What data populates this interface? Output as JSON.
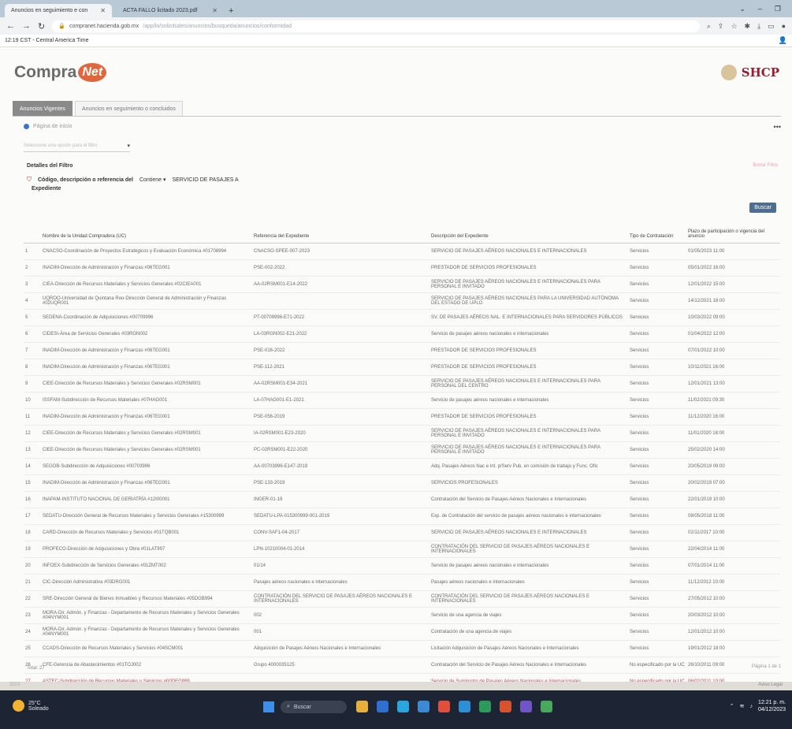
{
  "browser": {
    "tabs": [
      {
        "label": "Anuncios en seguimiento e con"
      },
      {
        "label": "ACTA FALLO licitado 2023.pdf"
      }
    ],
    "url_prefix": "compranet.hacienda.gob.mx",
    "url_rest": "/app/lo/solicitudes/anuncios/busqueda/anuncios/conformidad",
    "bookmark_item": "12:19 CST - Central America Time"
  },
  "site": {
    "logo_text": "Compra",
    "logo_net": "Net",
    "shcp_label": "SHCP"
  },
  "page_tabs": [
    {
      "label": "Anuncios Vigentes"
    },
    {
      "label": "Anuncios en seguimiento o concluidos"
    }
  ],
  "home_label": "Página de inicio",
  "select_placeholder": "Seleccione una opción para el filtro",
  "filters": {
    "title": "Detalles del Filtro",
    "clear": "Borrar Filtro",
    "field": "Código, descripción o referencia del",
    "field_2": "Expediente",
    "operator": "Contiene ▾",
    "value": "SERVICIO DE PASAJES A"
  },
  "search_button": "Buscar",
  "table": {
    "headers": [
      "",
      "Nombre de la Unidad Compradora (UC)",
      "Referencia del Expediente",
      "Descripción del Expediente",
      "Tipo de Contratación",
      "Plazo de participación o vigencia del anuncio"
    ],
    "rows": [
      [
        "1",
        "CNACSO-Coordinación de Proyectos Estratégicos y Evaluación Económica #01708994",
        "CNACSO-SPEE-007-2023",
        "SERVICIO DE PASAJES AÉREOS NACIONALES E INTERNACIONALES",
        "Servicios",
        "01/05/2023 11:00"
      ],
      [
        "2",
        "INADIM-Dirección de Administración y Finanzas #06TEG001",
        "PSE-002-2022",
        "PRESTADOR DE SERVICIOS PROFESIONALES",
        "Servicios",
        "05/01/2022 16:00"
      ],
      [
        "3",
        "CIEA-Dirección de Recursos Materiales y Servicios Generales #02CIEA001",
        "AA-02RSM001-E14-2022",
        "SERVICIO DE PASAJES AÉREOS NACIONALES E INTERNACIONALES PARA PERSONAL E INVITADO",
        "Servicios",
        "12/01/2022 15:00"
      ],
      [
        "4",
        "UQROO-Universidad de Quintana Roo-Dirección General de Administración y Finanzas #02UQR001",
        "",
        "SERVICIO DE PASAJES AÉREOS NACIONALES PARA LA UNIVERSIDAD AUTÓNOMA DEL ESTADO DE UPLO",
        "Servicios",
        "14/12/2021 16:00"
      ],
      [
        "5",
        "SEDENA-Coordinación de Adquisiciones #00709996",
        "PT-00709996-E71-2022",
        "SV. DE PASAJES AÉREOS NAL. E INTERNACIONALES PARA SERVIDORES PÚBLICOS",
        "Servicios",
        "10/03/2022 09:00"
      ],
      [
        "6",
        "CIDESI-Área de Servicios Generales #03RGN002",
        "LA-03RGN002-E21-2022",
        "Servicio de pasajes aéreos nacionales e internacionales",
        "Servicios",
        "01/04/2022 12:00"
      ],
      [
        "7",
        "INADIM-Dirección de Administración y Finanzas #06TEG001",
        "PSE-016-2022",
        "PRESTADOR DE SERVICIOS PROFESIONALES",
        "Servicios",
        "07/01/2022 10:00"
      ],
      [
        "8",
        "INADIM-Dirección de Administración y Finanzas #06TEG001",
        "PSE-112-2021",
        "PRESTADOR DE SERVICIOS PROFESIONALES",
        "Servicios",
        "10/11/2021 16:00"
      ],
      [
        "9",
        "CIEE-Dirección de Recursos Materiales y Servicios Generales #02RSM001",
        "AA-02RSM001-E34-2021",
        "SERVICIO DE PASAJES AÉREOS NACIONALES E INTERNACIONALES PARA PERSONAL DEL CENTRO",
        "Servicios",
        "12/01/2021 13:00"
      ],
      [
        "10",
        "ISSFAM-Subdirección de Recursos Materiales #07HAG001",
        "LA-07HAG001-E1-2021",
        "Servicio de pasajes aéreos nacionales e internacionales",
        "Servicios",
        "11/02/2021 09:30"
      ],
      [
        "11",
        "INADIM-Dirección de Administración y Finanzas #06TEG001",
        "PSE-056-2019",
        "PRESTADOR DE SERVICIOS PROFESIONALES",
        "Servicios",
        "11/12/2020 16:00"
      ],
      [
        "12",
        "CIEE-Dirección de Recursos Materiales y Servicios Generales #02RSM001",
        "IA-02RSM001-E23-2020",
        "SERVICIO DE PASAJES AÉREOS NACIONALES E INTERNACIONALES PARA PERSONAL E INVITADO",
        "Servicios",
        "11/01/2020 16:00"
      ],
      [
        "13",
        "CIEE-Dirección de Recursos Materiales y Servicios Generales #02RSM001",
        "PC-02RSM001-E22-2020",
        "SERVICIO DE PASAJES AÉREOS NACIONALES E INTERNACIONALES PARA PERSONAL E INVITADO",
        "Servicios",
        "25/02/2020 14:00"
      ],
      [
        "14",
        "SEGOB-Subdirección de Adquisiciones #00703996",
        "AA-00703996-E147-2019",
        "Adq. Pasajes Aéreos Nac e Int. p/Serv Pub. en comisión de trabajo y Func. Ofic",
        "Servicios",
        "20/05/2019 09:00"
      ],
      [
        "15",
        "INADIM-Dirección de Administración y Finanzas #06TEG001",
        "PSE-133-2019",
        "SERVICIOS PROFESIONALES",
        "Servicios",
        "20/02/2019 07:00"
      ],
      [
        "16",
        "INAPAM-INSTITUTO NACIONAL DE GERIATRÍA #12I00001",
        "INGER-01-19",
        "Contratación del Servicio de Pasajes Aéreos Nacionales e Internacionales",
        "Servicios",
        "22/01/2019 10:00"
      ],
      [
        "17",
        "SEDATU-Dirección General de Recursos Materiales y Servicios Generales #15300999",
        "SEDATU-LPA-015300999-001-2019",
        "Exp. de Contratación del servicio de pasajes aéreos nacionales e internacionales",
        "Servicios",
        "08/05/2018 11:00"
      ],
      [
        "18",
        "CARD-Dirección de Recursos Materiales y Servicios #01TQB001",
        "CONV-SAF1-04-2017",
        "SERVICIO DE PASAJES AÉREOS NACIONALES E INTERNACIONALES",
        "Servicios",
        "02/11/2017 10:00"
      ],
      [
        "19",
        "PROFECO-Dirección de Adquisiciones y Obra #01LAT997",
        "LPN-10210004-01-2014",
        "CONTRATACIÓN DEL SERVICIO DE PASAJES AÉREOS NACIONALES E INTERNACIONALES",
        "Servicios",
        "22/04/2014 11:00"
      ],
      [
        "20",
        "INFOEX-Subdirección de Servicios Generales #01ZMT002",
        "01/14",
        "Servicio de pasajes aéreos nacionales e internacionales",
        "Servicios",
        "07/01/2014 11:00"
      ],
      [
        "21",
        "CIC-Dirección Administrativa #03DRG001",
        "Pasajes aéreos nacionales e internacionales",
        "Pasajes aéreos nacionales e internacionales",
        "Servicios",
        "11/12/2012 10:00"
      ],
      [
        "22",
        "SRE-Dirección General de Bienes Inmuebles y Recursos Materiales #05DGB994",
        "CONTRATACIÓN DEL SERVICIO DE PASAJES AÉREOS NACIONALES E INTERNACIONALES",
        "CONTRATACIÓN DEL SERVICIO DE PASAJES AÉREOS NACIONALES E INTERNACIONALES",
        "Servicios",
        "27/05/2012 10:00"
      ],
      [
        "23",
        "MORA-Dir. Admón. y Finanzas - Departamento de Recursos Materiales y Servicios Generales #04NYM001",
        "002",
        "Servicio de una agencia de viajes",
        "Servicios",
        "20/03/2012 10:00"
      ],
      [
        "24",
        "MORA-Dir. Admón. y Finanzas - Departamento de Recursos Materiales y Servicios Generales #04NYM001",
        "001",
        "Contratación de una agencia de viajes",
        "Servicios",
        "12/01/2012 10:00"
      ],
      [
        "25",
        "CCADS-Dirección de Recursos Materiales y Servicios #04SCM001",
        "Adquisición de Pasajes Aéreos Nacionales e Internacionales",
        "Licitación Adquisición de Pasajes Aéreos Nacionales e Internacionales",
        "Servicios",
        "19/01/2012 18:00"
      ],
      [
        "26",
        "CFE-Gerencia de Abastecimientos #01TOJ002",
        "Grupo 4000035125",
        "Contratación del Servicio de Pasajes Aéreos Nacionales e Internacionales",
        "No especificado por la UC",
        "26/10/2011 09:00"
      ],
      [
        "27",
        "ASTEC-Subdirección de Recursos Materiales y Servicios #00DEG999",
        "",
        "Servicio de Suministro de Pasajes Aéreos Nacionales e Internacionales",
        "No especificado por la UC",
        "06/02/2011 10:00"
      ]
    ]
  },
  "footer": {
    "total": "Total: 27",
    "pages": "Página 1 de 1",
    "bottom_left": "2023",
    "bottom_right": "Aviso Legal"
  },
  "taskbar": {
    "temp": "25°C",
    "weather": "Soleado",
    "search": "Buscar",
    "time": "12:21 p. m.",
    "date": "04/12/2023"
  }
}
